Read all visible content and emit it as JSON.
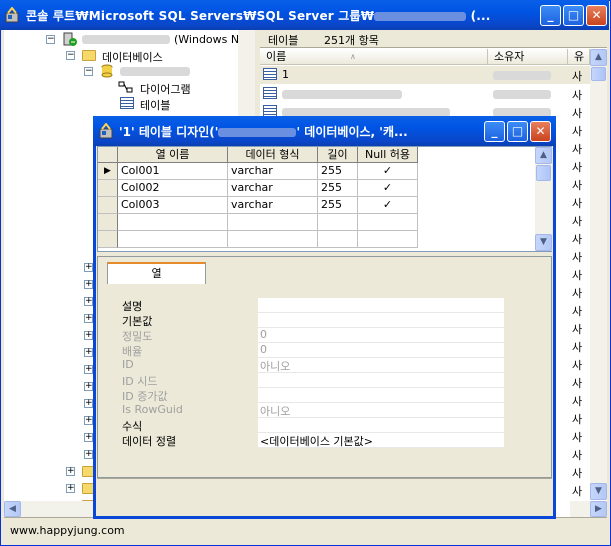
{
  "window": {
    "title": "콘솔 루트₩Microsoft SQL Servers₩SQL Server 그룹₩",
    "title_suffix": "(...",
    "buttons": {
      "minimize": "_",
      "maximize": "□",
      "close": "✕"
    }
  },
  "tree": {
    "server_suffix": "(Windows N",
    "items": [
      {
        "label": "데이터베이스"
      },
      {
        "label": "다이어그램"
      },
      {
        "label": "테이블"
      }
    ]
  },
  "list": {
    "tab_label": "테이블",
    "count_label": "251개 항목",
    "columns": [
      "이름",
      "소유자",
      "유형"
    ],
    "rows": [
      {
        "name": "1",
        "owner": "",
        "type": "사"
      },
      {
        "name": "",
        "owner": "",
        "type": "사"
      },
      {
        "name": "",
        "owner": "",
        "type": "사"
      }
    ],
    "type_value": "사"
  },
  "dialog": {
    "title_prefix": "'1' 테이블 디자인('",
    "title_suffix": "' 데이터베이스, '캐...",
    "grid": {
      "columns": [
        "열 이름",
        "데이터 형식",
        "길이",
        "Null 허용"
      ],
      "rows": [
        {
          "name": "Col001",
          "type": "varchar",
          "length": "255",
          "nullable": "✓"
        },
        {
          "name": "Col002",
          "type": "varchar",
          "length": "255",
          "nullable": "✓"
        },
        {
          "name": "Col003",
          "type": "varchar",
          "length": "255",
          "nullable": "✓"
        }
      ],
      "current_row_marker": "▶"
    },
    "tab_label": "열",
    "properties": [
      {
        "label": "설명",
        "value": "",
        "disabled": false
      },
      {
        "label": "기본값",
        "value": "",
        "disabled": false
      },
      {
        "label": "정밀도",
        "value": "0",
        "disabled": true
      },
      {
        "label": "배율",
        "value": "0",
        "disabled": true
      },
      {
        "label": "ID",
        "value": "아니오",
        "disabled": true
      },
      {
        "label": "ID 시드",
        "value": "",
        "disabled": true
      },
      {
        "label": "ID 증가값",
        "value": "",
        "disabled": true
      },
      {
        "label": "Is RowGuid",
        "value": "아니오",
        "disabled": true
      },
      {
        "label": "수식",
        "value": "",
        "disabled": false
      },
      {
        "label": "데이터 정렬",
        "value": "<데이터베이스 기본값>",
        "disabled": false
      }
    ]
  },
  "status": {
    "text": "www.happyjung.com"
  }
}
